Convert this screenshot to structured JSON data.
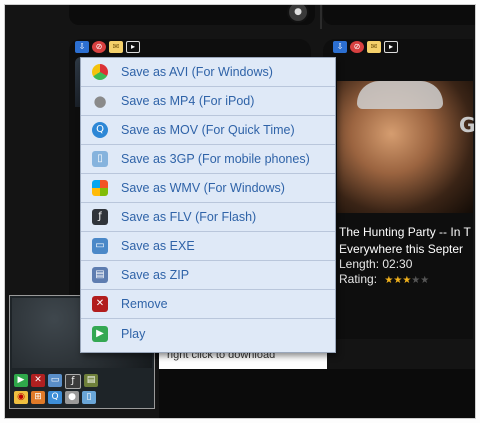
{
  "menu": {
    "items": [
      {
        "label": "Save as AVI (For Windows)",
        "icon": "chrome-icon"
      },
      {
        "label": "Save as MP4 (For iPod)",
        "icon": "apple-icon"
      },
      {
        "label": "Save as MOV (For Quick Time)",
        "icon": "quicktime-icon"
      },
      {
        "label": "Save as 3GP (For mobile phones)",
        "icon": "mobile-phone-icon"
      },
      {
        "label": "Save as WMV (For Windows)",
        "icon": "windows-icon"
      },
      {
        "label": "Save as FLV (For Flash)",
        "icon": "flash-icon"
      },
      {
        "label": "Save as EXE",
        "icon": "exe-icon"
      },
      {
        "label": "Save as ZIP",
        "icon": "zip-icon"
      },
      {
        "label": "Remove",
        "icon": "remove-icon"
      },
      {
        "label": "Play",
        "icon": "play-icon"
      }
    ]
  },
  "movie": {
    "title": "The Hunting Party -- In T",
    "tagline": "Everywhere this Septer",
    "length": "Length: 02:30",
    "rating_label": "Rating:",
    "rating_stars": 3,
    "rating_max": 5,
    "poster_letter": "G"
  },
  "hint": {
    "text": "right click to download"
  },
  "colors": {
    "menu_bg": "#dfe9f7",
    "menu_text": "#2f63a8",
    "star": "#f2b21c"
  }
}
